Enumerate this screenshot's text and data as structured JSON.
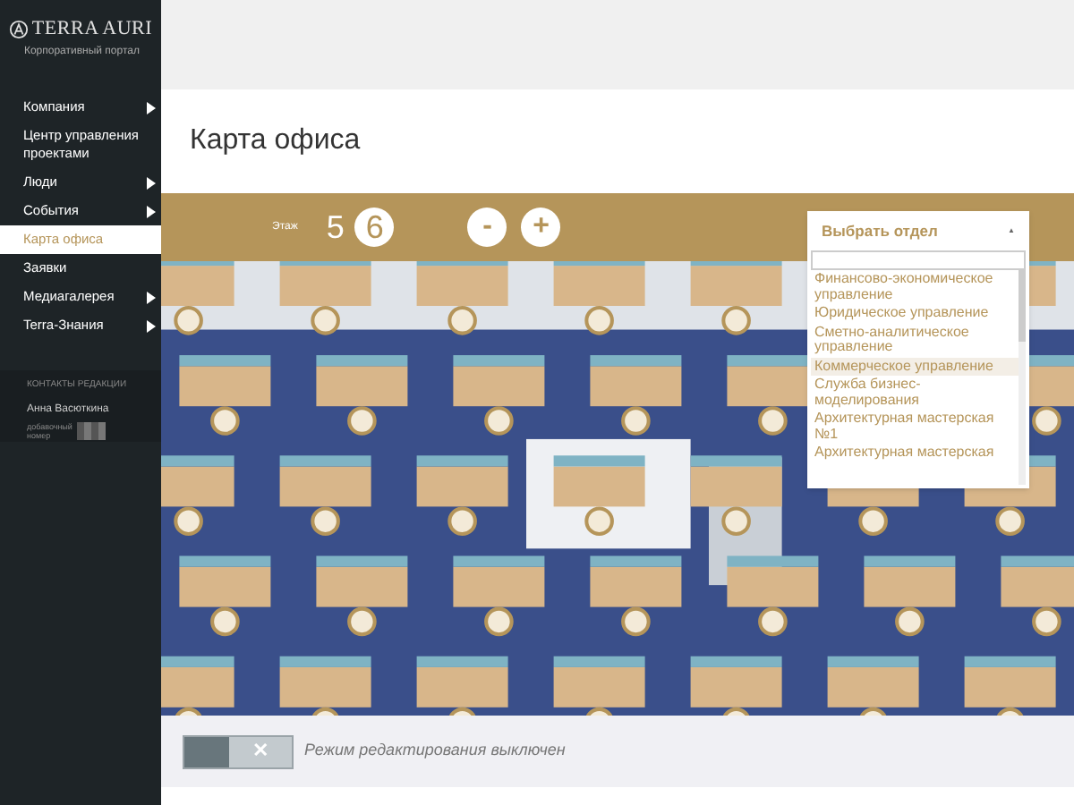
{
  "logo": {
    "name": "TERRA AURI",
    "subtitle": "Корпоративный портал"
  },
  "sidebar": {
    "items": [
      {
        "label": "Компания",
        "has_submenu": true,
        "selected": false
      },
      {
        "label": "Центр управления проектами",
        "has_submenu": false,
        "selected": false
      },
      {
        "label": "Люди",
        "has_submenu": true,
        "selected": false
      },
      {
        "label": "События",
        "has_submenu": true,
        "selected": false
      },
      {
        "label": "Карта офиса",
        "has_submenu": false,
        "selected": true
      },
      {
        "label": "Заявки",
        "has_submenu": false,
        "selected": false
      },
      {
        "label": "Медиагалерея",
        "has_submenu": true,
        "selected": false
      },
      {
        "label": "Terra-Знания",
        "has_submenu": true,
        "selected": false
      }
    ],
    "contacts": {
      "heading": "КОНТАКТЫ РЕДАКЦИИ",
      "name": "Анна Васюткина",
      "extension_label": "добавочный номер"
    }
  },
  "page": {
    "title": "Карта офиса"
  },
  "toolbar": {
    "floor_label": "Этаж",
    "floors": [
      {
        "label": "5",
        "selected": false
      },
      {
        "label": "6",
        "selected": true
      }
    ],
    "zoom_buttons": [
      "-",
      "+"
    ],
    "department_select": {
      "label": "Выбрать отдел",
      "caret": "▲",
      "options": [
        {
          "label": "Финансово-экономическое управление",
          "selected": false
        },
        {
          "label": "Юридическое управление",
          "selected": false
        },
        {
          "label": "Сметно-аналитическое управление",
          "selected": false
        },
        {
          "label": "Коммерческое управление",
          "selected": true
        },
        {
          "label": "Служба бизнес-моделирования",
          "selected": false
        },
        {
          "label": "Архитектурная мастерская №1",
          "selected": false
        },
        {
          "label": "Архитектурная мастерская",
          "selected": false
        }
      ]
    }
  },
  "edit_mode": {
    "on": false,
    "off_symbol": "✕",
    "label": "Режим редактирования выключен"
  }
}
